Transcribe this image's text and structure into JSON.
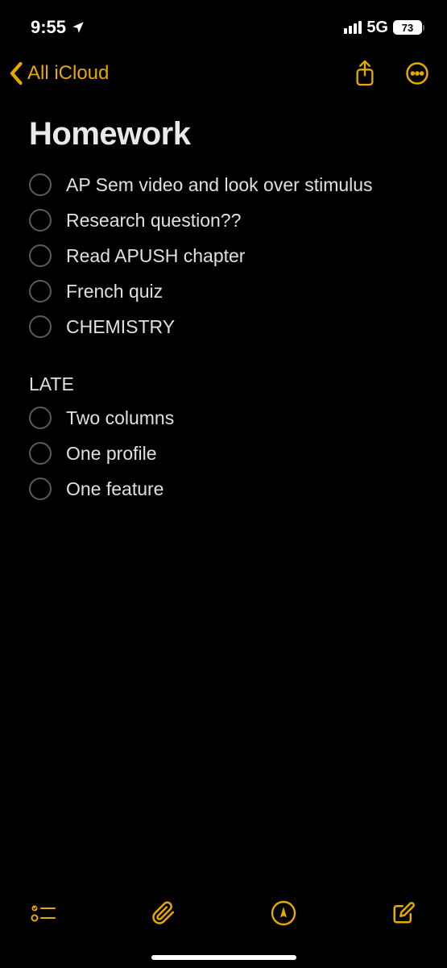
{
  "status": {
    "time": "9:55",
    "network": "5G",
    "battery": "73"
  },
  "nav": {
    "back_label": "All iCloud"
  },
  "note": {
    "title": "Homework",
    "items": [
      "AP Sem video and look over stimulus",
      "Research question??",
      "Read APUSH chapter",
      "French quiz",
      "CHEMISTRY"
    ],
    "section_label": "LATE",
    "late_items": [
      "Two columns",
      "One profile",
      "One feature"
    ]
  },
  "colors": {
    "accent": "#e6a900"
  }
}
